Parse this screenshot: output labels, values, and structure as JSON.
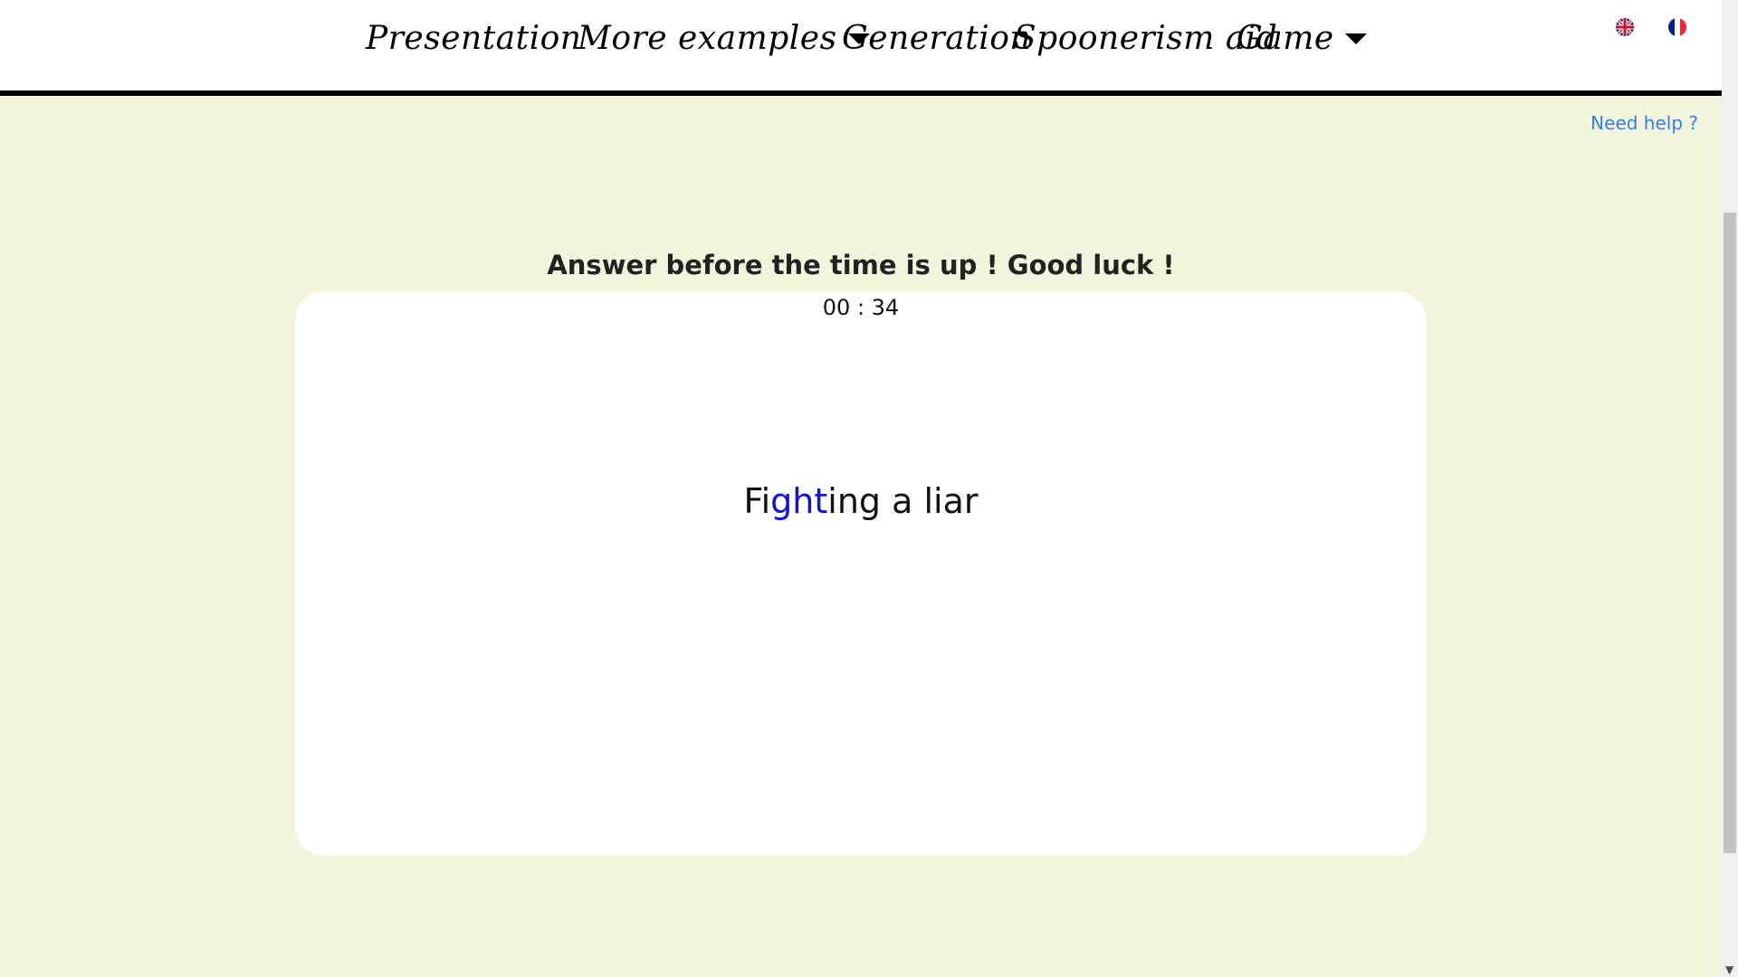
{
  "nav": {
    "items": [
      {
        "label": "Presentation",
        "dropdown": false
      },
      {
        "label": "More examples",
        "dropdown": true
      },
      {
        "label": "Generation",
        "dropdown": false
      },
      {
        "label": "Spoonerism aid",
        "dropdown": false
      },
      {
        "label": "Game",
        "dropdown": true
      }
    ],
    "flags": [
      "uk-flag-icon",
      "france-flag-icon"
    ]
  },
  "help": {
    "label": "Need help ?"
  },
  "game": {
    "heading": "Answer before the time is up ! Good luck !",
    "timer": "00 : 34",
    "phrase": {
      "before": "Fi",
      "highlight": "ght",
      "after": "ing a liar"
    }
  },
  "colors": {
    "background": "#f4f4dc",
    "link": "#2f7fe6",
    "highlight": "#1010dd",
    "nav_border": "#000000"
  }
}
